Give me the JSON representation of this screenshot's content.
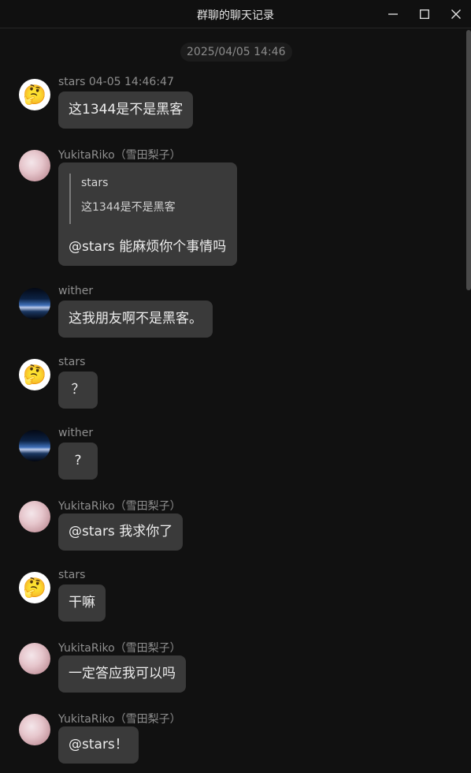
{
  "window": {
    "title": "群聊的聊天记录"
  },
  "date_separator": "2025/04/05 14:46",
  "messages": [
    {
      "sender": "stars 04-05 14:46:47",
      "text": "这1344是不是黑客",
      "avatar": "thinking-face-emoji"
    },
    {
      "sender": "YukitaRiko（雪田梨子）",
      "quote_sender": "stars",
      "quote_text": "这1344是不是黑客",
      "text": "@stars 能麻烦你个事情吗",
      "avatar": "anime-girl-avatar"
    },
    {
      "sender": "wither",
      "text": "这我朋友啊不是黑客。",
      "avatar": "night-sky-avatar"
    },
    {
      "sender": "stars",
      "text": "？",
      "avatar": "thinking-face-emoji"
    },
    {
      "sender": "wither",
      "text": "?",
      "avatar": "night-sky-avatar"
    },
    {
      "sender": "YukitaRiko（雪田梨子）",
      "text": "@stars 我求你了",
      "avatar": "anime-girl-avatar"
    },
    {
      "sender": "stars",
      "text": "干嘛",
      "avatar": "thinking-face-emoji"
    },
    {
      "sender": "YukitaRiko（雪田梨子）",
      "text": "一定答应我可以吗",
      "avatar": "anime-girl-avatar"
    },
    {
      "sender": "YukitaRiko（雪田梨子）",
      "text": "@stars！",
      "avatar": "anime-girl-avatar"
    }
  ],
  "emoji": {
    "thinking": "🤔"
  }
}
